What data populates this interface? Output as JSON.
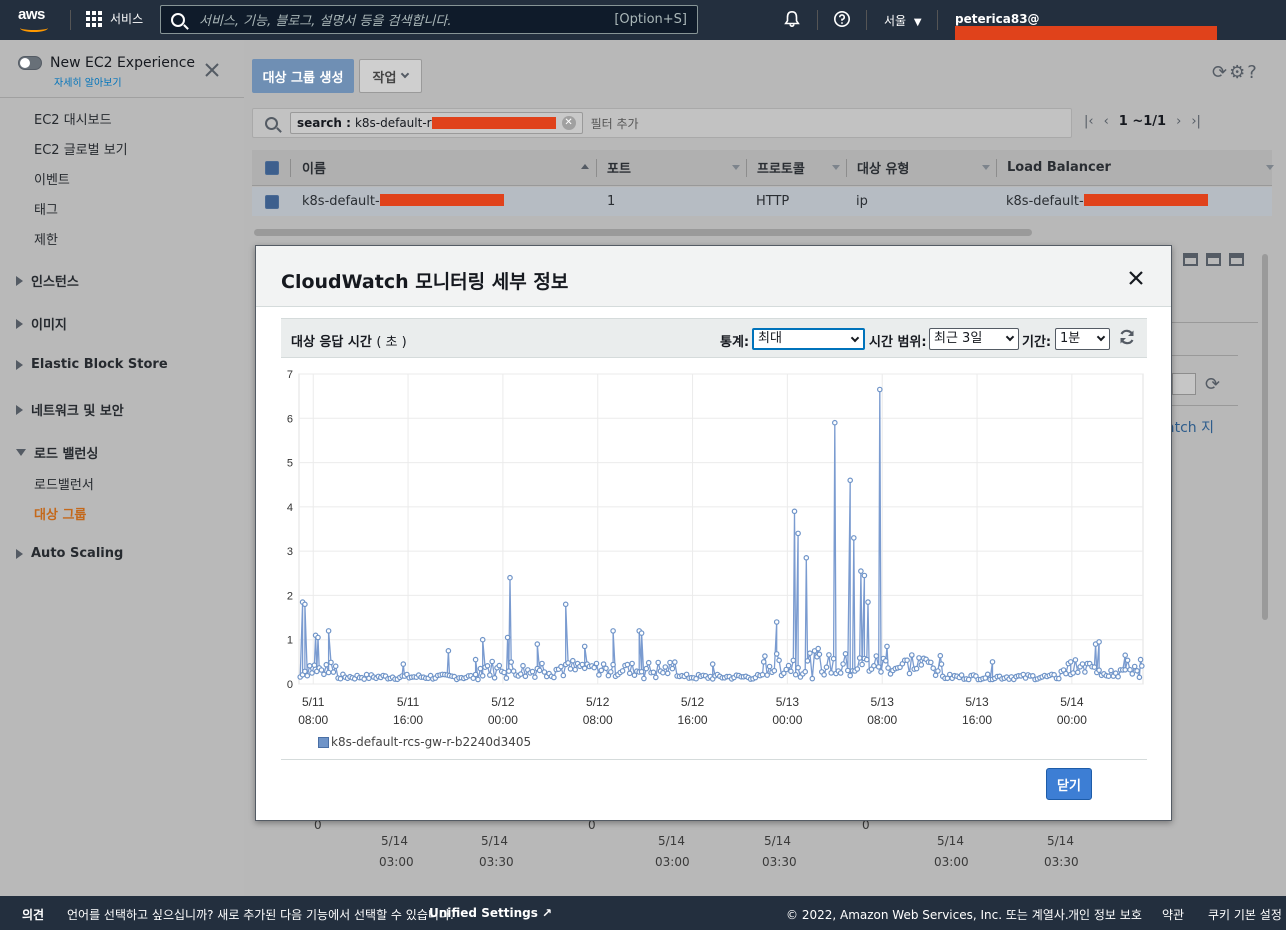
{
  "topnav": {
    "logo": "aws",
    "services_label": "서비스",
    "search_placeholder": "서비스, 기능, 블로그, 설명서 등을 검색합니다.",
    "search_shortcut": "[Option+S]",
    "region": "서울",
    "account": "peterica83@"
  },
  "sidebar": {
    "experience_toggle": "New EC2 Experience",
    "learn_more": "자세히 알아보기",
    "items_top": [
      "EC2 대시보드",
      "EC2 글로벌 보기",
      "이벤트",
      "태그",
      "제한"
    ],
    "sections": {
      "instances": "인스턴스",
      "images": "이미지",
      "ebs": "Elastic Block Store",
      "network": "네트워크 및 보안",
      "lb": "로드 밸런싱",
      "autoscaling": "Auto Scaling"
    },
    "lb_children": [
      "로드밸런서",
      "대상 그룹"
    ]
  },
  "main": {
    "create_button": "대상 그룹 생성",
    "actions_button": "작업",
    "filter_key": "search",
    "filter_value": "k8s-default-r",
    "filter_add": "필터 추가",
    "pager": "1 ~1/1",
    "columns": [
      "이름",
      "포트",
      "프로토콜",
      "대상 유형",
      "Load Balancer"
    ],
    "row": {
      "name": "k8s-default-",
      "port": "1",
      "protocol": "HTTP",
      "target_type": "ip",
      "load_balancer": "k8s-default-"
    },
    "bg_link": "atch 지",
    "bg_axis": {
      "zeros": [
        "0",
        "0",
        "0"
      ],
      "dates": [
        "5/14",
        "5/14",
        "5/14",
        "5/14",
        "5/14",
        "5/14"
      ],
      "times": [
        "03:00",
        "03:30",
        "03:00",
        "03:30",
        "03:00",
        "03:30"
      ]
    }
  },
  "modal": {
    "title": "CloudWatch 모니터링 세부 정보",
    "chart_title": "대상 응답 시간",
    "chart_unit": "( 초 )",
    "stat_label": "통계:",
    "stat_value": "최대",
    "range_label": "시간 범위:",
    "range_value": "최근 3일",
    "period_label": "기간:",
    "period_value": "1분",
    "close_button": "닫기"
  },
  "footer": {
    "feedback": "의견",
    "language_prompt": "언어를 선택하고 싶으십니까? 새로 추가된 다음 기능에서 선택할 수 있습니다.",
    "unified_settings": "Unified Settings",
    "copyright": "© 2022, Amazon Web Services, Inc. 또는 계열사.",
    "privacy": "개인 정보 보호",
    "terms": "약관",
    "cookies": "쿠키 기본 설정"
  },
  "colors": {
    "nav_bg": "#232f3e",
    "primary": "#3d7ed4",
    "series": "#6f94c8",
    "redaction": "#e0421b",
    "active_nav": "#c4681a"
  },
  "chart_data": {
    "type": "line",
    "title": "대상 응답 시간",
    "unit": "초",
    "series": [
      {
        "name": "k8s-default-rcs-gw-r-b2240d3405"
      }
    ],
    "x_ticks": [
      {
        "date": "5/11",
        "time": "08:00"
      },
      {
        "date": "5/11",
        "time": "16:00"
      },
      {
        "date": "5/12",
        "time": "00:00"
      },
      {
        "date": "5/12",
        "time": "08:00"
      },
      {
        "date": "5/12",
        "time": "16:00"
      },
      {
        "date": "5/13",
        "time": "00:00"
      },
      {
        "date": "5/13",
        "time": "08:00"
      },
      {
        "date": "5/13",
        "time": "16:00"
      },
      {
        "date": "5/14",
        "time": "00:00"
      }
    ],
    "y_ticks": [
      "0",
      "1",
      "2",
      "3",
      "4",
      "5",
      "6",
      "7"
    ],
    "ylim": [
      0,
      7
    ],
    "xrange_hours": [
      -1.2,
      70
    ],
    "grid": true,
    "legend": "bottom-left",
    "baseline": 0.1,
    "spikes": [
      [
        -0.9,
        1.85
      ],
      [
        -0.7,
        1.8
      ],
      [
        0.2,
        1.1
      ],
      [
        0.4,
        1.05
      ],
      [
        1.3,
        1.2
      ],
      [
        7.6,
        0.45
      ],
      [
        11.4,
        0.75
      ],
      [
        13.7,
        0.55
      ],
      [
        14.3,
        1.0
      ],
      [
        16.4,
        1.05
      ],
      [
        16.6,
        2.4
      ],
      [
        18.9,
        0.9
      ],
      [
        21.3,
        1.8
      ],
      [
        22.9,
        0.85
      ],
      [
        25.3,
        1.2
      ],
      [
        27.5,
        1.2
      ],
      [
        27.7,
        1.15
      ],
      [
        33.7,
        0.45
      ],
      [
        38.0,
        0.5
      ],
      [
        39.1,
        1.4
      ],
      [
        40.6,
        3.9
      ],
      [
        40.9,
        3.4
      ],
      [
        41.6,
        2.85
      ],
      [
        42.6,
        0.8
      ],
      [
        44.0,
        5.9
      ],
      [
        45.3,
        4.6
      ],
      [
        45.6,
        3.3
      ],
      [
        46.2,
        2.55
      ],
      [
        46.5,
        2.45
      ],
      [
        46.8,
        1.85
      ],
      [
        47.8,
        6.65
      ],
      [
        48.4,
        0.85
      ],
      [
        50.5,
        0.65
      ],
      [
        53.0,
        0.45
      ],
      [
        57.3,
        0.5
      ],
      [
        63.9,
        0.5
      ],
      [
        66.0,
        0.9
      ],
      [
        66.3,
        0.95
      ],
      [
        68.5,
        0.65
      ],
      [
        69.8,
        0.55
      ]
    ]
  }
}
